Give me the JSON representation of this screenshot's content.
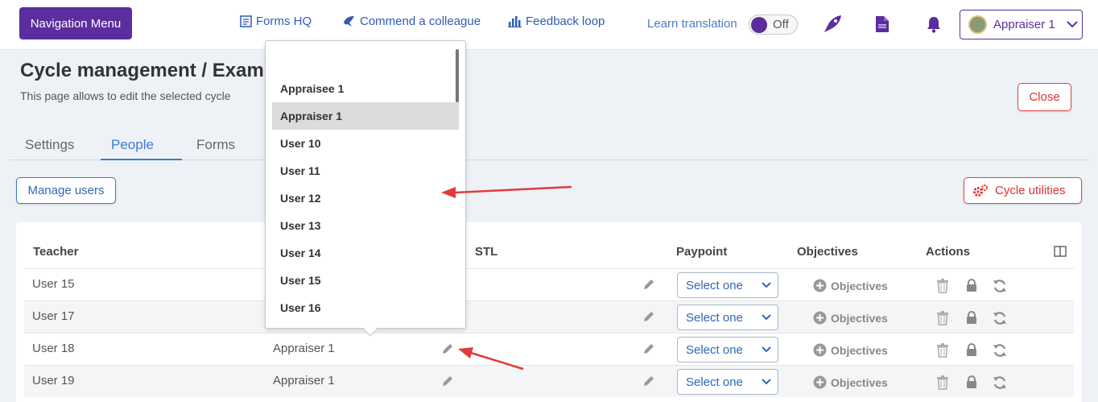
{
  "topbar": {
    "nav_button": "Navigation Menu",
    "links": [
      {
        "label": "Forms HQ",
        "icon": "form-icon"
      },
      {
        "label": "Commend a colleague",
        "icon": "bird-icon"
      },
      {
        "label": "Feedback loop",
        "icon": "bar-chart-icon"
      }
    ],
    "learn_translation": "Learn translation",
    "toggle_state": "Off",
    "user_label": "Appraiser 1"
  },
  "page": {
    "title": "Cycle management / Exam",
    "subtitle": "This page allows to edit the selected cycle",
    "close_label": "Close"
  },
  "tabs": [
    "Settings",
    "People",
    "Forms"
  ],
  "active_tab": "People",
  "manage_users_label": "Manage users",
  "cycle_utilities_label": "Cycle utilities",
  "table": {
    "headers": {
      "teacher": "Teacher",
      "stl": "STL",
      "paypoint": "Paypoint",
      "objectives": "Objectives",
      "actions": "Actions"
    },
    "rows": [
      {
        "teacher": "User 15",
        "appraiser": "",
        "paypoint": "Select one",
        "objectives": "Objectives"
      },
      {
        "teacher": "User 17",
        "appraiser": "",
        "paypoint": "Select one",
        "objectives": "Objectives"
      },
      {
        "teacher": "User 18",
        "appraiser": "Appraiser 1",
        "paypoint": "Select one",
        "objectives": "Objectives"
      },
      {
        "teacher": "User 19",
        "appraiser": "Appraiser 1",
        "paypoint": "Select one",
        "objectives": "Objectives"
      }
    ]
  },
  "dropdown": {
    "items": [
      "",
      "Appraisee 1",
      "Appraiser 1",
      "User 10",
      "User 11",
      "User 12",
      "User 13",
      "User 14",
      "User 15",
      "User 16"
    ],
    "selected": "Appraiser 1"
  },
  "colors": {
    "brand": "#5b2d9e",
    "link": "#2f5bb5",
    "danger": "#d33333",
    "annotation_arrow": "#e03c3c"
  }
}
